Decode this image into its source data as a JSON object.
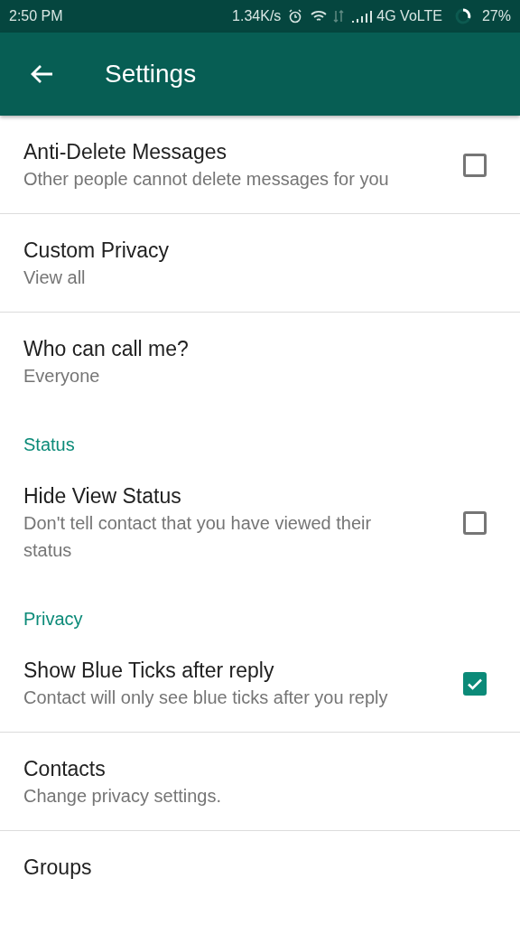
{
  "status_bar": {
    "time": "2:50 PM",
    "speed": "1.34K/s",
    "network": "4G VoLTE",
    "battery": "27%"
  },
  "app_bar": {
    "title": "Settings"
  },
  "items": [
    {
      "kind": "checkbox",
      "title": "Anti-Delete Messages",
      "subtitle": "Other people cannot delete messages for you",
      "checked": false
    },
    {
      "kind": "setting",
      "title": "Custom Privacy",
      "subtitle": "View all"
    },
    {
      "kind": "setting",
      "title": "Who can call me?",
      "subtitle": "Everyone"
    },
    {
      "kind": "header",
      "title": "Status"
    },
    {
      "kind": "checkbox",
      "title": "Hide View Status",
      "subtitle": "Don't tell contact that you have viewed their status",
      "checked": false
    },
    {
      "kind": "header",
      "title": "Privacy"
    },
    {
      "kind": "checkbox",
      "title": "Show Blue Ticks after reply",
      "subtitle": "Contact will only see blue ticks after you reply",
      "checked": true
    },
    {
      "kind": "setting",
      "title": "Contacts",
      "subtitle": "Change privacy settings."
    },
    {
      "kind": "setting",
      "title": "Groups"
    }
  ]
}
